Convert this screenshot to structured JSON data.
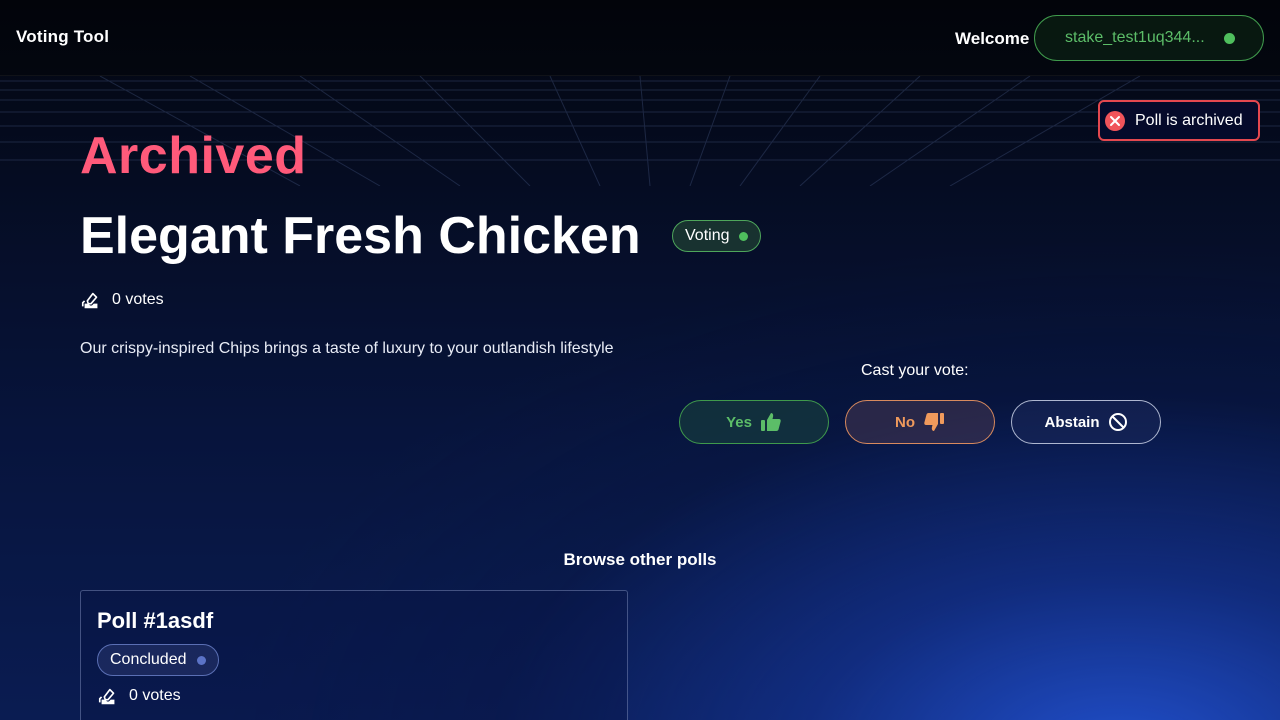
{
  "header": {
    "brand": "Voting Tool",
    "welcome": "Welcome",
    "wallet_address": "stake_test1uq344..."
  },
  "toast": {
    "message": "Poll is archived",
    "icon": "close-circle-icon"
  },
  "poll": {
    "status_heading": "Archived",
    "title": "Elegant Fresh Chicken",
    "badge": "Voting",
    "votes": "0 votes",
    "description": "Our crispy-inspired Chips brings a taste of luxury to your outlandish lifestyle"
  },
  "vote": {
    "cast_label": "Cast your vote:",
    "yes_label": "Yes",
    "no_label": "No",
    "abstain_label": "Abstain"
  },
  "browse": {
    "heading": "Browse other polls",
    "cards": [
      {
        "title": "Poll #1asdf",
        "badge": "Concluded",
        "votes": "0 votes"
      }
    ]
  },
  "colors": {
    "archived": "#ff5a7a",
    "voting_green": "#4fbf5d",
    "no_orange": "#f09a5c",
    "toast_red": "#e4484f"
  }
}
